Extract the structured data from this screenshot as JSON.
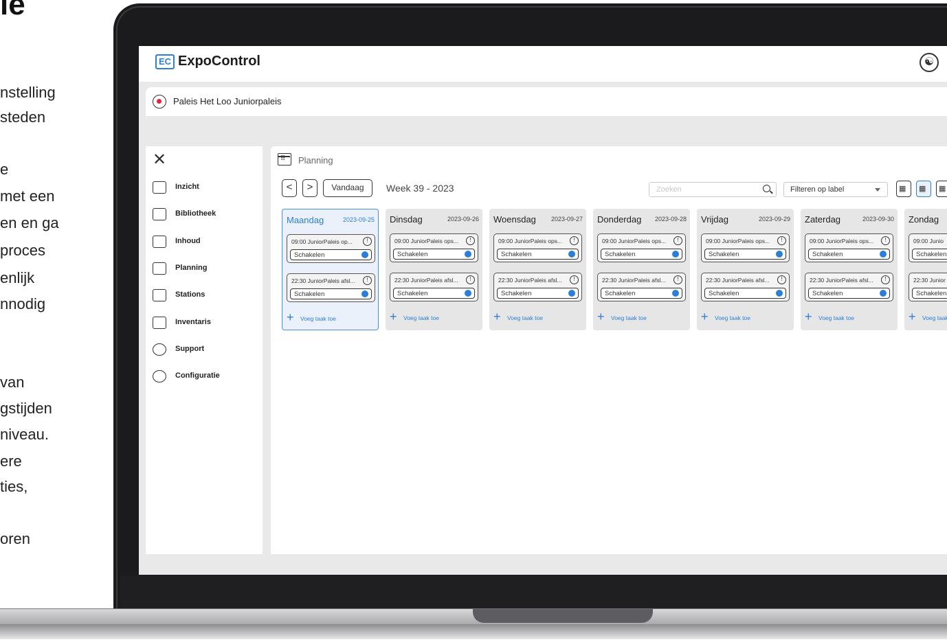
{
  "article": {
    "title": "ie",
    "lines": [
      "nstelling",
      "steden",
      "e",
      "met een",
      "en en ga",
      "proces",
      "enlijk",
      "nnodig",
      "van",
      "gstijden",
      "niveau.",
      "ere",
      "ties,",
      "oren"
    ]
  },
  "app": {
    "logo_mark": "EC",
    "logo_text": "ExpoControl",
    "location": "Paleis Het Loo Juniorpaleis"
  },
  "sidebar": {
    "items": [
      {
        "label": "Inzicht",
        "icon": "insight-icon"
      },
      {
        "label": "Bibliotheek",
        "icon": "library-icon"
      },
      {
        "label": "Inhoud",
        "icon": "content-icon"
      },
      {
        "label": "Planning",
        "icon": "calendar-icon"
      },
      {
        "label": "Stations",
        "icon": "stations-icon"
      },
      {
        "label": "Inventaris",
        "icon": "inventory-icon"
      },
      {
        "label": "Support",
        "icon": "headset-icon"
      },
      {
        "label": "Configuratie",
        "icon": "gear-icon"
      }
    ]
  },
  "planning": {
    "title": "Planning",
    "prev": "<",
    "next": ">",
    "today": "Vandaag",
    "week": "Week 39 - 2023",
    "search_placeholder": "Zoeken",
    "filter": "Filteren op label",
    "add_task": "Voeg taak toe",
    "days": [
      {
        "name": "Maandag",
        "date": "2023-09-25",
        "active": true,
        "tasks": [
          {
            "text": "09:00 JuniorPaleis op...",
            "toggle": "Schakelen"
          },
          {
            "text": "22:30 JuniorPaleis afsl...",
            "toggle": "Schakelen"
          }
        ]
      },
      {
        "name": "Dinsdag",
        "date": "2023-09-26",
        "tasks": [
          {
            "text": "09:00 JuniorPaleis ops...",
            "toggle": "Schakelen"
          },
          {
            "text": "22:30 JuniorPaleis afsl...",
            "toggle": "Schakelen"
          }
        ]
      },
      {
        "name": "Woensdag",
        "date": "2023-09-27",
        "tasks": [
          {
            "text": "09:00 JuniorPaleis ops...",
            "toggle": "Schakelen"
          },
          {
            "text": "22:30 JuniorPaleis afsl...",
            "toggle": "Schakelen"
          }
        ]
      },
      {
        "name": "Donderdag",
        "date": "2023-09-28",
        "tasks": [
          {
            "text": "09:00 JuniorPaleis ops...",
            "toggle": "Schakelen"
          },
          {
            "text": "22:30 JuniorPaleis afsl...",
            "toggle": "Schakelen"
          }
        ]
      },
      {
        "name": "Vrijdag",
        "date": "2023-09-29",
        "tasks": [
          {
            "text": "09:00 JuniorPaleis ops...",
            "toggle": "Schakelen"
          },
          {
            "text": "22:30 JuniorPaleis afsl...",
            "toggle": "Schakelen"
          }
        ]
      },
      {
        "name": "Zaterdag",
        "date": "2023-09-30",
        "tasks": [
          {
            "text": "09:00 JuniorPaleis ops...",
            "toggle": "Schakelen"
          },
          {
            "text": "22:30 JuniorPaleis afsl...",
            "toggle": "Schakelen"
          }
        ]
      },
      {
        "name": "Zondag",
        "date": "",
        "tasks": [
          {
            "text": "09:00 Junio",
            "toggle": "Schakelen"
          },
          {
            "text": "22:30 Junior",
            "toggle": "Schakelen"
          }
        ]
      }
    ]
  },
  "colors": {
    "accent": "#2b7fd6",
    "active_day_bg": "#eaf1fa",
    "day_bg": "#e6e6e6"
  }
}
